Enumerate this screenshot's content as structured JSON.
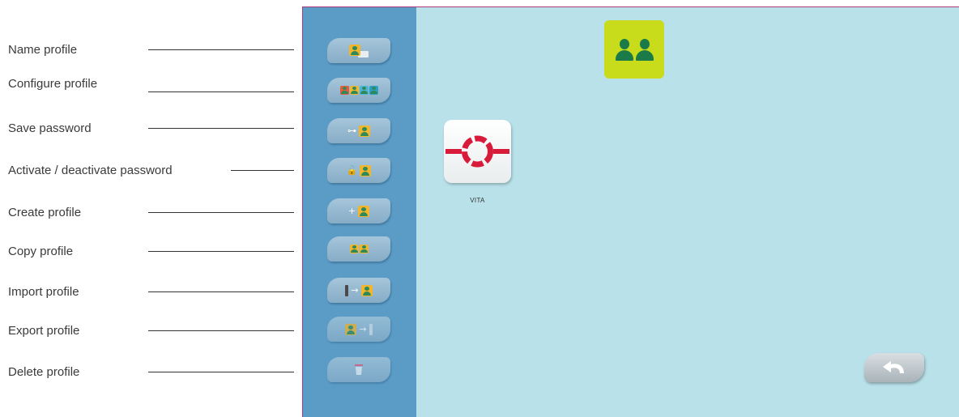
{
  "callouts": [
    {
      "id": "name",
      "label": "Name profile"
    },
    {
      "id": "configure",
      "label": "Configure profile"
    },
    {
      "id": "save-password",
      "label": "Save password"
    },
    {
      "id": "activate-password",
      "label": "Activate / deactivate password"
    },
    {
      "id": "create",
      "label": "Create profile"
    },
    {
      "id": "copy",
      "label": "Copy profile"
    },
    {
      "id": "import",
      "label": "Import profile"
    },
    {
      "id": "export",
      "label": "Export profile"
    },
    {
      "id": "delete",
      "label": "Delete profile"
    }
  ],
  "sidebar": {
    "buttons": [
      {
        "action": "name-profile",
        "icon": "profile-card-icon"
      },
      {
        "action": "configure-profile",
        "icon": "multi-profile-settings-icon"
      },
      {
        "action": "save-password",
        "icon": "key-icon"
      },
      {
        "action": "activate-deactivate-password",
        "icon": "padlock-icon"
      },
      {
        "action": "create-profile",
        "icon": "plus-profile-icon"
      },
      {
        "action": "copy-profile",
        "icon": "duplicate-profile-icon"
      },
      {
        "action": "import-profile",
        "icon": "import-arrow-icon"
      },
      {
        "action": "export-profile",
        "icon": "export-arrow-icon"
      },
      {
        "action": "delete-profile",
        "icon": "trash-icon"
      }
    ]
  },
  "main": {
    "header_icon": "two-users-icon",
    "apps": [
      {
        "label": "VITA",
        "icon": "vita-ring-icon",
        "icon_color": "#d81b3a"
      }
    ],
    "back_button_icon": "undo-arrow-icon"
  },
  "colors": {
    "sidebar_bg": "#5b9cc7",
    "content_bg": "#b9e1ea",
    "frame_border": "#b03a7c",
    "profile_tile": "#c8dc1c",
    "profile_icon": "#f2b52c",
    "person_icon": "#1a7a48"
  }
}
